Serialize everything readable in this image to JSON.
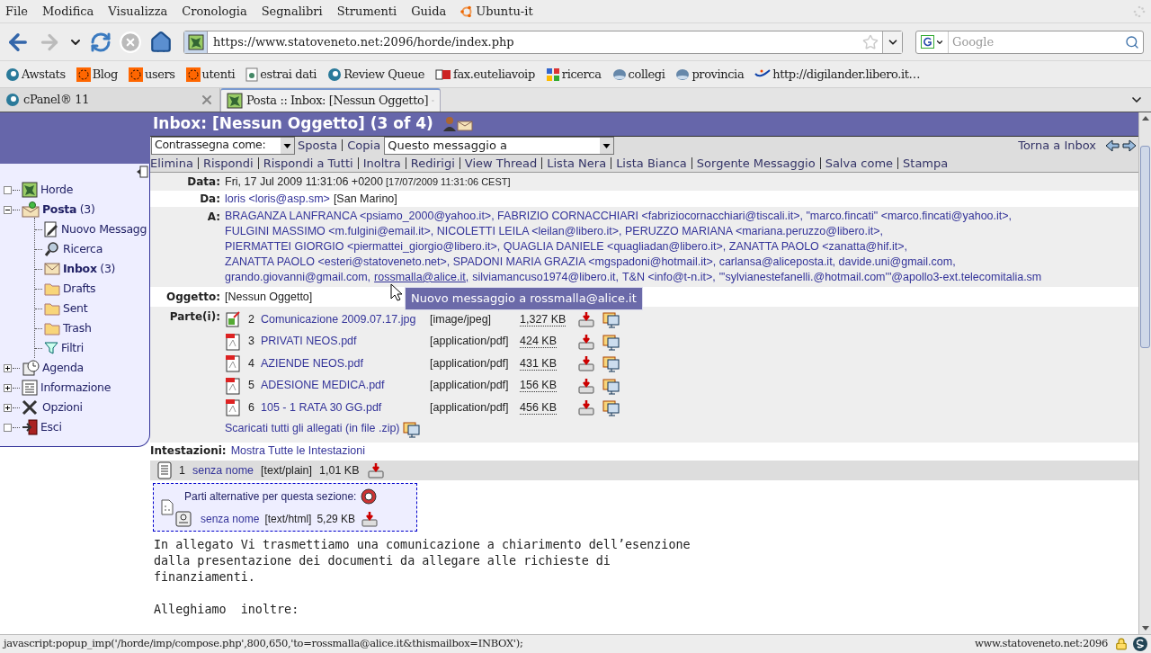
{
  "menu": [
    "File",
    "Modifica",
    "Visualizza",
    "Cronologia",
    "Segnalibri",
    "Strumenti",
    "Guida",
    "Ubuntu-it"
  ],
  "address": {
    "value": "https://www.statoveneto.net:2096/horde/index.php"
  },
  "search": {
    "placeholder": "Google"
  },
  "bookmarks": [
    {
      "label": "Awstats",
      "kind": "cpanel"
    },
    {
      "label": "Blog",
      "kind": "dots"
    },
    {
      "label": "users",
      "kind": "dots"
    },
    {
      "label": "utenti",
      "kind": "dots"
    },
    {
      "label": "estrai dati",
      "kind": "page"
    },
    {
      "label": "Review Queue",
      "kind": "cpanel"
    },
    {
      "label": "fax.euteliavoip",
      "kind": "fax"
    },
    {
      "label": "ricerca",
      "kind": "google"
    },
    {
      "label": "collegi",
      "kind": "globe"
    },
    {
      "label": "provincia",
      "kind": "globe"
    },
    {
      "label": "http://digilander.libero.it…",
      "kind": "libero"
    }
  ],
  "tabs": [
    {
      "label": "cPanel® 11",
      "selected": false
    },
    {
      "label": "Posta :: Inbox: [Nessun Oggetto]",
      "selected": true
    }
  ],
  "page": {
    "title": "Inbox: [Nessun Oggetto] (3 of 4)",
    "mark_select": "Contrassegna come:",
    "move": "Sposta",
    "copy": "Copia",
    "message_select": "Questo messaggio a",
    "back": "Torna a Inbox",
    "actions": [
      "Elimina",
      "Rispondi",
      "Rispondi a Tutti",
      "Inoltra",
      "Redirigi",
      "View Thread",
      "Lista Nera",
      "Lista Bianca",
      "Sorgente Messaggio",
      "Salva come",
      "Stampa"
    ]
  },
  "sidebar": [
    {
      "label": "Horde",
      "kind": "leaf"
    },
    {
      "label": "Posta",
      "count": "(3)",
      "kind": "folder",
      "expanded": true,
      "children": [
        {
          "label": "Nuovo Messagg",
          "selected": false
        },
        {
          "label": "Ricerca",
          "selected": false
        },
        {
          "label": "Inbox",
          "count": "(3)",
          "selected": true
        },
        {
          "label": "Drafts",
          "selected": false
        },
        {
          "label": "Sent",
          "selected": false
        },
        {
          "label": "Trash",
          "selected": false
        },
        {
          "label": "Filtri",
          "selected": false
        }
      ]
    },
    {
      "label": "Agenda",
      "kind": "folder",
      "expanded": false
    },
    {
      "label": "Informazione",
      "kind": "folder",
      "expanded": false
    },
    {
      "label": "Opzioni",
      "kind": "folder",
      "expanded": false
    },
    {
      "label": "Esci",
      "kind": "leaf"
    }
  ],
  "headers": {
    "date_label": "Data:",
    "date": "Fri, 17 Jul 2009 11:31:06 +0200",
    "date_local": "[17/07/2009 11:31:06 CEST]",
    "from_label": "Da:",
    "from": "loris <loris@asp.sm>",
    "from_note": "[San Marino]",
    "to_label": "A:",
    "to_lines": [
      "BRAGANZA LANFRANCA <psiamo_2000@yahoo.it>, FABRIZIO CORNACCHIARI <fabriziocornacchiari@tiscali.it>, \"marco.fincati\" <marco.fincati@yahoo.it>,",
      "FULGINI MASSIMO <m.fulgini@email.it>, NICOLETTI LEILA <leilan@libero.it>, PERUZZO MARIANA <mariana.peruzzo@libero.it>,",
      "PIERMATTEI GIORGIO <piermattei_giorgio@libero.it>, QUAGLIA DANIELE <quagliadan@libero.it>, ZANATTA PAOLO <zanatta@hif.it>,",
      "ZANATTA PAOLO <esteri@statoveneto.net>, SPADONI MARIA GRAZIA <mgspadoni@hotmail.it>, carlansa@aliceposta.it, davide.uni@gmail.com,"
    ],
    "to_last": [
      {
        "text": "grando.giovanni@gmail.com,",
        "hovered": false
      },
      {
        "text": "rossmalla@alice.it,",
        "hovered": true
      },
      {
        "text": "silviamancuso1974@libero.it,",
        "hovered": false
      },
      {
        "text": "T&N <info@t-n.it>,",
        "hovered": false
      },
      {
        "text": "\"'sylvianestefanelli.@hotmail.com'\"@apollo3-ext.telecomitalia.sm",
        "hovered": false
      }
    ],
    "subject_label": "Oggetto:",
    "subject": "[Nessun Oggetto]",
    "parts_label": "Parte(i):",
    "parts": [
      {
        "num": "2",
        "name": "Comunicazione 2009.07.17.jpg",
        "type": "[image/jpeg]",
        "size": "1,327 KB",
        "kind": "image"
      },
      {
        "num": "3",
        "name": "PRIVATI NEOS.pdf",
        "type": "[application/pdf]",
        "size": "424 KB",
        "kind": "pdf"
      },
      {
        "num": "4",
        "name": "AZIENDE NEOS.pdf",
        "type": "[application/pdf]",
        "size": "431 KB",
        "kind": "pdf"
      },
      {
        "num": "5",
        "name": "ADESIONE MEDICA.pdf",
        "type": "[application/pdf]",
        "size": "156 KB",
        "kind": "pdf"
      },
      {
        "num": "6",
        "name": "105 - 1 RATA 30 GG.pdf",
        "type": "[application/pdf]",
        "size": "456 KB",
        "kind": "pdf"
      }
    ],
    "zip": "Scaricati tutti gli allegati (in file .zip)",
    "headers_label": "Intestazioni:",
    "headers_link": "Mostra Tutte le Intestazioni"
  },
  "tooltip": "Nuovo messaggio a rossmalla@alice.it",
  "body": {
    "part": {
      "num": "1",
      "name": "senza nome",
      "type": "[text/plain]",
      "size": "1,01 KB"
    },
    "alt_title": "Parti alternative per questa sezione:",
    "alt_part": {
      "name": "senza nome",
      "type": "[text/html]",
      "size": "5,29 KB"
    },
    "paragraphs": [
      [
        "In allegato Vi trasmettiamo una comunicazione a chiarimento dell’esenzione",
        "dalla presentazione dei documenti da allegare alle richieste di",
        "finanziamenti."
      ],
      [
        "Alleghiamo  inoltre:"
      ]
    ]
  },
  "status": {
    "text": "javascript:popup_imp('/horde/imp/compose.php',800,650,'to=rossmalla@alice.it&thismailbox=INBOX');",
    "host": "www.statoveneto.net:2096"
  }
}
